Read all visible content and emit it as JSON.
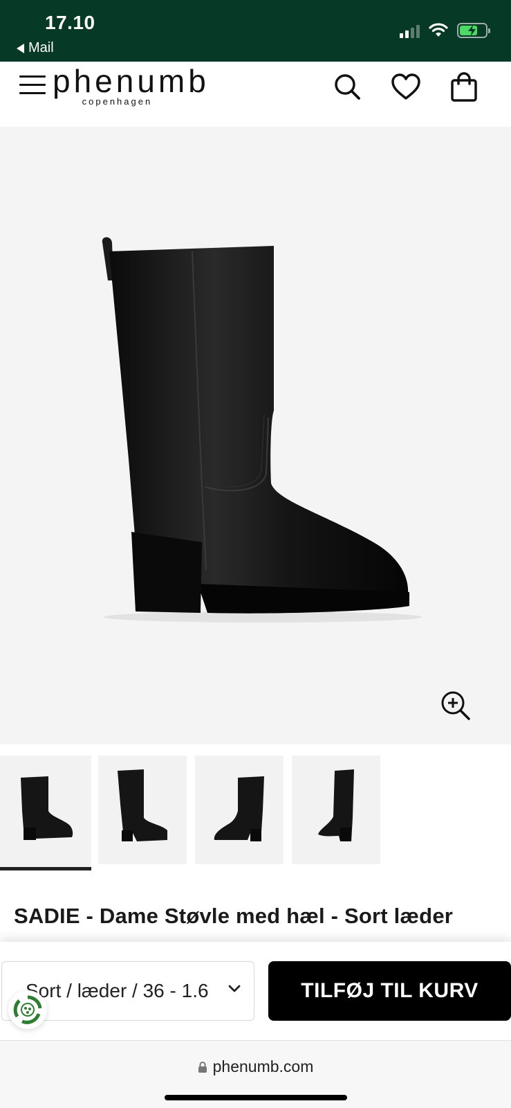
{
  "status_bar": {
    "time": "17.10",
    "back_label": "Mail"
  },
  "header": {
    "logo_main": "phenumb",
    "logo_sub": "copenhagen",
    "icons": [
      "menu-icon",
      "search-icon",
      "heart-icon",
      "bag-icon"
    ]
  },
  "gallery": {
    "image": "black-leather-heeled-boot",
    "thumbnails": [
      "boot-side-view",
      "boot-front-view",
      "boot-inner-view",
      "boot-back-view"
    ],
    "active_thumbnail": 0
  },
  "product": {
    "title": "SADIE - Dame Støvle med hæl - Sort læder"
  },
  "cart": {
    "variant_selected": "Sort / læder / 36 - 1.6",
    "add_button_label": "TILFØJ TIL KURV"
  },
  "browser": {
    "url": "phenumb.com"
  },
  "colors": {
    "status_bar": "#063a26",
    "button": "#000000",
    "gallery_bg": "#f4f4f4"
  }
}
